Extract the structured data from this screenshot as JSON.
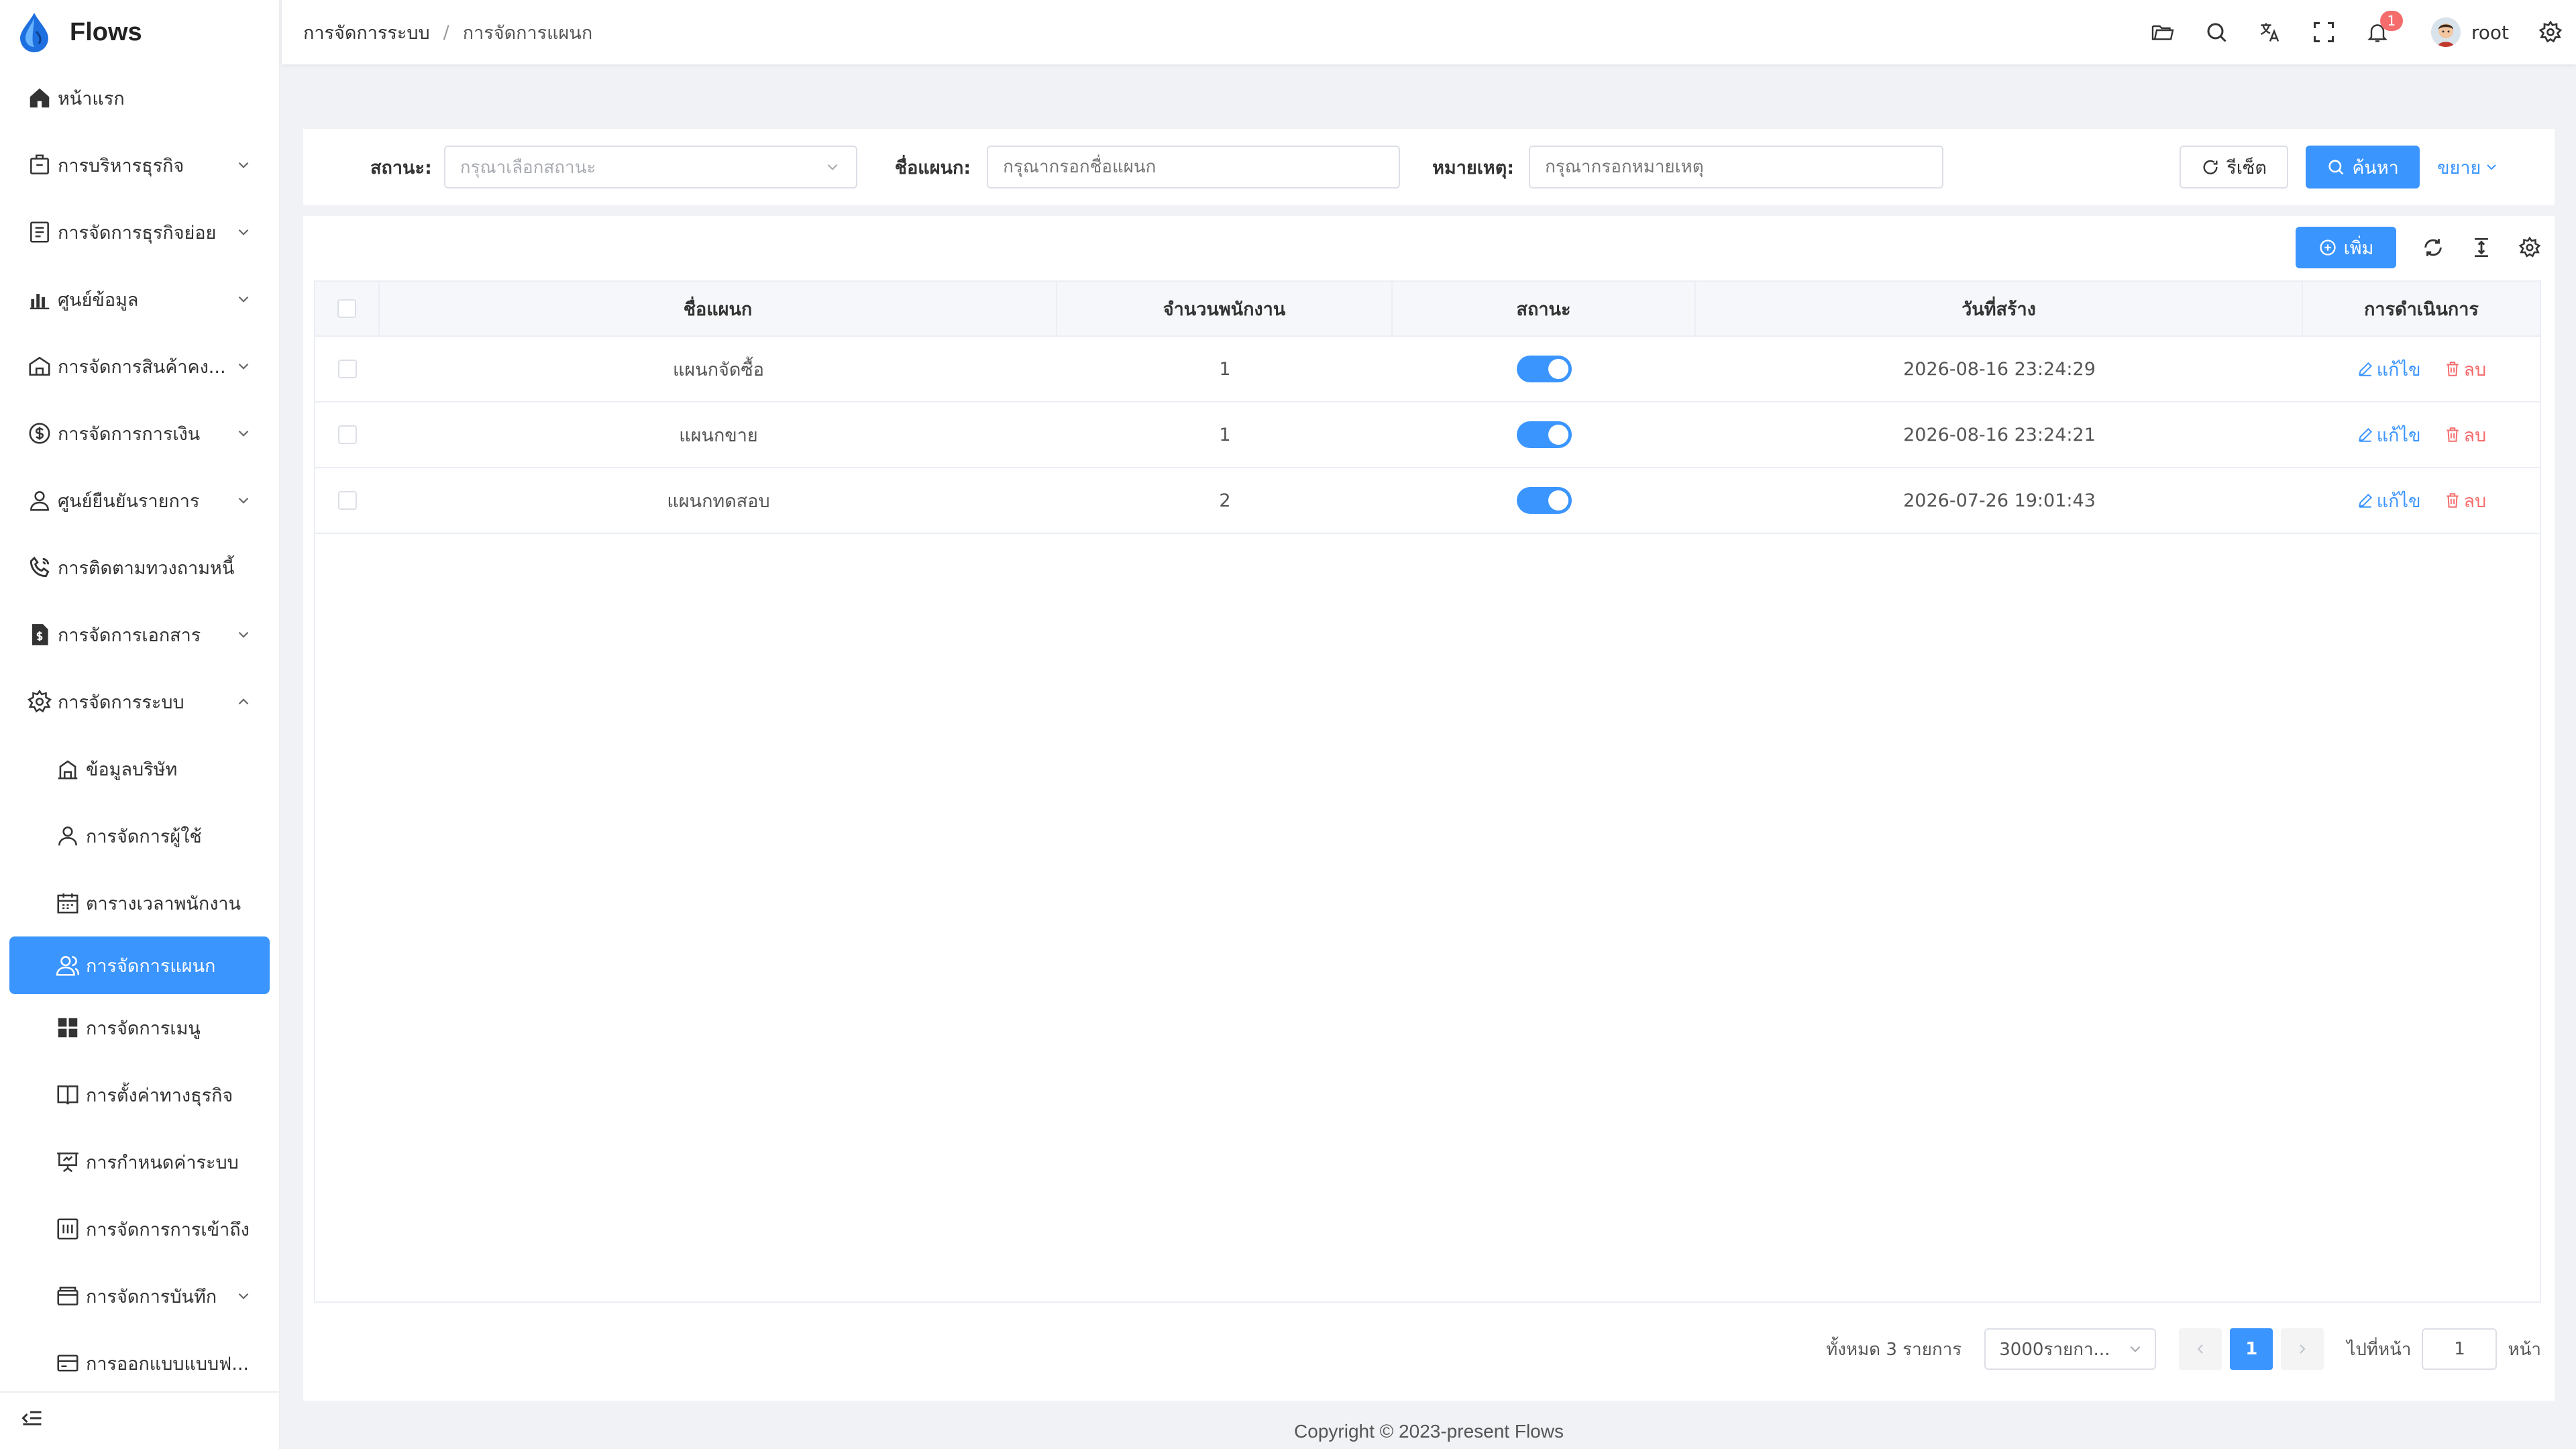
{
  "app": {
    "name": "Flows"
  },
  "colors": {
    "primary": "#3b95ff",
    "danger": "#f56c6c",
    "badge": "#f56c6c"
  },
  "sidebar": {
    "items": [
      {
        "label": "หน้าแรก",
        "icon": "home-icon",
        "chevron": false
      },
      {
        "label": "การบริหารธุรกิจ",
        "icon": "briefcase-icon",
        "chevron": true
      },
      {
        "label": "การจัดการธุรกิจย่อย",
        "icon": "document-list-icon",
        "chevron": true
      },
      {
        "label": "ศูนย์ข้อมูล",
        "icon": "bar-chart-icon",
        "chevron": true
      },
      {
        "label": "การจัดการสินค้าคง...",
        "icon": "warehouse-icon",
        "chevron": true
      },
      {
        "label": "การจัดการการเงิน",
        "icon": "money-circle-icon",
        "chevron": true
      },
      {
        "label": "ศูนย์ยืนยันรายการ",
        "icon": "user-check-icon",
        "chevron": true
      },
      {
        "label": "การติดตามทวงถามหนี้",
        "icon": "phone-call-icon",
        "chevron": false
      },
      {
        "label": "การจัดการเอกสาร",
        "icon": "file-dollar-icon",
        "chevron": true
      },
      {
        "label": "การจัดการระบบ",
        "icon": "gear-icon",
        "chevron": true,
        "expanded": true
      }
    ],
    "sub_items": [
      {
        "label": "ข้อมูลบริษัท",
        "icon": "building-icon"
      },
      {
        "label": "การจัดการผู้ใช้",
        "icon": "user-icon"
      },
      {
        "label": "ตารางเวลาพนักงาน",
        "icon": "calendar-icon"
      },
      {
        "label": "การจัดการแผนก",
        "icon": "team-icon",
        "active": true
      },
      {
        "label": "การจัดการเมนู",
        "icon": "grid-icon"
      },
      {
        "label": "การตั้งค่าทางธุรกิจ",
        "icon": "book-icon"
      },
      {
        "label": "การกำหนดค่าระบบ",
        "icon": "presentation-icon"
      },
      {
        "label": "การจัดการการเข้าถึง",
        "icon": "access-icon"
      },
      {
        "label": "การจัดการบันทึก",
        "icon": "wallet-icon",
        "chevron": true
      },
      {
        "label": "การออกแบบแบบฟ...",
        "icon": "card-icon"
      }
    ]
  },
  "header": {
    "breadcrumb": [
      "การจัดการระบบ",
      "การจัดการแผนก"
    ],
    "notification_count": "1",
    "username": "root"
  },
  "search": {
    "status_label": "สถานะ:",
    "status_placeholder": "กรุณาเลือกสถานะ",
    "dept_label": "ชื่อแผนก:",
    "dept_placeholder": "กรุณากรอกชื่อแผนก",
    "note_label": "หมายเหตุ:",
    "note_placeholder": "กรุณากรอกหมายเหตุ",
    "reset_label": "รีเซ็ต",
    "search_label": "ค้นหา",
    "expand_label": "ขยาย"
  },
  "toolbar": {
    "add_label": "เพิ่ม"
  },
  "table": {
    "headers": [
      "ชื่อแผนก",
      "จำนวนพนักงาน",
      "สถานะ",
      "วันที่สร้าง",
      "การดำเนินการ"
    ],
    "rows": [
      {
        "name": "แผนกจัดซื้อ",
        "count": "1",
        "status": true,
        "created": "2026-08-16 23:24:29"
      },
      {
        "name": "แผนกขาย",
        "count": "1",
        "status": true,
        "created": "2026-08-16 23:24:21"
      },
      {
        "name": "แผนกทดสอบ",
        "count": "2",
        "status": true,
        "created": "2026-07-26 19:01:43"
      }
    ],
    "edit_label": "แก้ไข",
    "delete_label": "ลบ"
  },
  "pagination": {
    "total_text": "ทั้งหมด 3 รายการ",
    "page_size": "3000รายกา...",
    "current_page": "1",
    "goto_label": "ไปที่หน้า",
    "goto_value": "1",
    "page_suffix": "หน้า"
  },
  "footer": {
    "copyright": "Copyright © 2023-present Flows"
  }
}
